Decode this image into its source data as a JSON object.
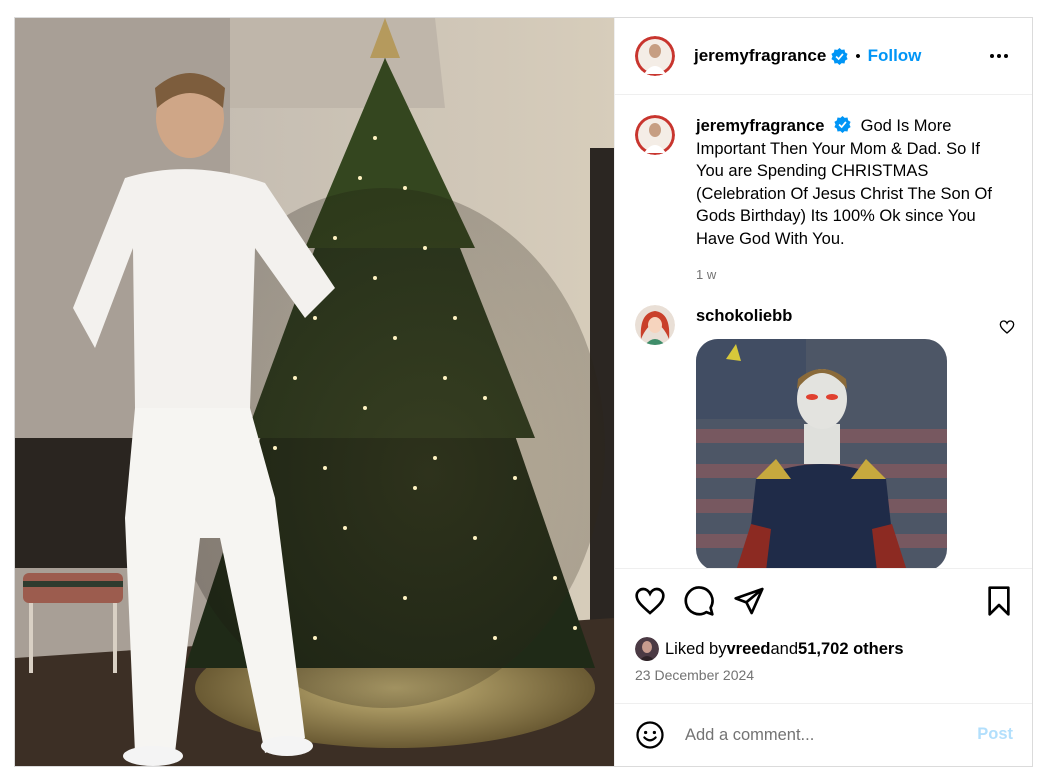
{
  "post": {
    "author": {
      "username": "jeremyfragrance",
      "verified_icon": "verified-badge-icon",
      "follow_label": "Follow",
      "separator": "•"
    },
    "caption": {
      "username": "jeremyfragrance",
      "text": "God Is More Important Then Your Mom & Dad. So If You are Spending CHRISTMAS (Celebration Of Jesus Christ The Son Of Gods Birthday) Its 100% Ok since You Have God With You.",
      "time": "1 w"
    },
    "comments": [
      {
        "username": "schokoliebb",
        "gif_icon": "superhero-gif"
      }
    ],
    "likes": {
      "prefix": "Liked by ",
      "first_user": "vreed",
      "middle": " and ",
      "others": "51,702 others"
    },
    "date": "23 December 2024",
    "add_comment": {
      "placeholder": "Add a comment...",
      "post_label": "Post"
    },
    "icons": {
      "like": "heart-icon",
      "comment": "comment-bubble-icon",
      "share": "paper-plane-icon",
      "save": "bookmark-icon",
      "more": "more-dots-icon",
      "emoji": "emoji-smile-icon"
    },
    "colors": {
      "accent": "#0095f6",
      "post_disabled": "#b2dffc",
      "muted": "#737373",
      "border": "#dbdbdb"
    }
  }
}
